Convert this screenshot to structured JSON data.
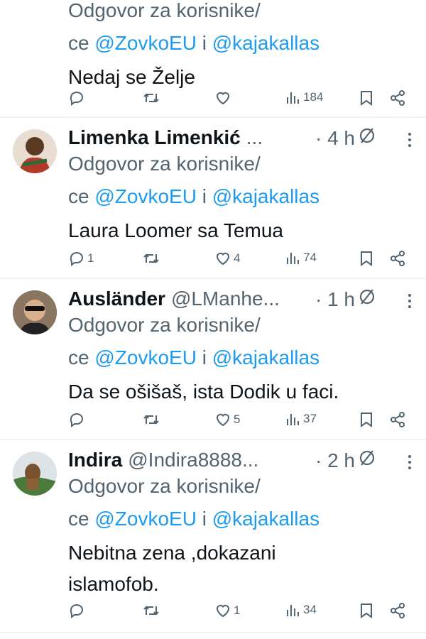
{
  "tweets": [
    {
      "id": "t0",
      "reply_prefix": "Odgovor za korisnike/",
      "reply_line2_prefix": "ce ",
      "mention1": "@ZovkoEU",
      "conj": " i ",
      "mention2": "@kajakallas",
      "text": "Nedaj se Želje",
      "replies": "",
      "retweets": "",
      "likes": "",
      "views": "184"
    },
    {
      "id": "t1",
      "name": "Limenka Limenkić",
      "handle": "...",
      "time": "· 4 h",
      "reply_prefix": "Odgovor za korisnike/",
      "reply_line2_prefix": "ce ",
      "mention1": "@ZovkoEU",
      "conj": " i ",
      "mention2": "@kajakallas",
      "text": "Laura Loomer sa Temua",
      "replies": "1",
      "retweets": "",
      "likes": "4",
      "views": "74"
    },
    {
      "id": "t2",
      "name": "Ausländer",
      "handle": "@LManhe...",
      "time": "· 1 h",
      "reply_prefix": "Odgovor za korisnike/",
      "reply_line2_prefix": "ce ",
      "mention1": "@ZovkoEU",
      "conj": " i ",
      "mention2": "@kajakallas",
      "text": "Da se ošišaš, ista Dodik u faci.",
      "replies": "",
      "retweets": "",
      "likes": "5",
      "views": "37"
    },
    {
      "id": "t3",
      "name": "Indira",
      "handle": "@Indira8888...",
      "time": "· 2 h",
      "reply_prefix": "Odgovor za korisnike/",
      "reply_line2_prefix": "ce ",
      "mention1": "@ZovkoEU",
      "conj": " i ",
      "mention2": "@kajakallas",
      "text_line1": "Nebitna zena ,dokazani",
      "text_line2": "islamofob.",
      "replies": "",
      "retweets": "",
      "likes": "1",
      "views": "34"
    }
  ],
  "colors": {
    "text": "#0f1419",
    "muted": "#536471",
    "link": "#1d9bf0",
    "border": "#eff3f4"
  },
  "icons": [
    "reply-icon",
    "retweet-icon",
    "like-icon",
    "views-icon",
    "bookmark-icon",
    "share-icon",
    "grok-icon",
    "more-icon"
  ]
}
